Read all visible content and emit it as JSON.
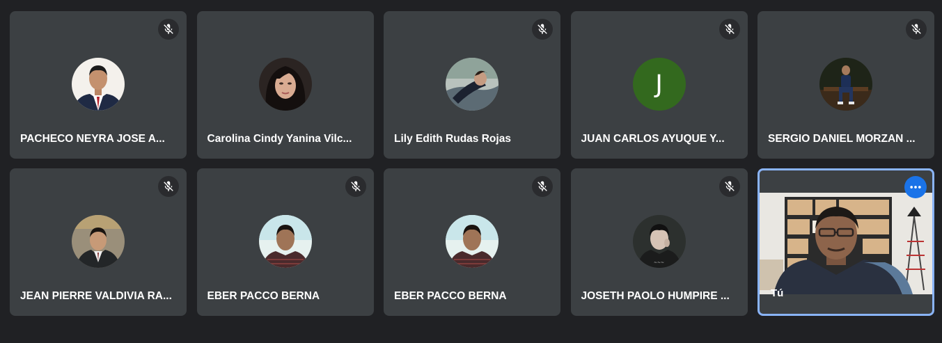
{
  "participants": [
    {
      "name": "PACHECO NEYRA JOSE A...",
      "muted": true,
      "avatar": "photo-suit-red-tie"
    },
    {
      "name": "Carolina Cindy Yanina Vilc...",
      "muted": false,
      "avatar": "photo-woman"
    },
    {
      "name": "Lily Edith Rudas Rojas",
      "muted": true,
      "avatar": "photo-outdoor"
    },
    {
      "name": "JUAN CARLOS AYUQUE Y...",
      "muted": true,
      "avatar": "letter",
      "initial": "J",
      "avatar_color": "#33691e"
    },
    {
      "name": "SERGIO DANIEL MORZAN ...",
      "muted": true,
      "avatar": "photo-sitting"
    },
    {
      "name": "JEAN PIERRE VALDIVIA RA...",
      "muted": true,
      "avatar": "photo-child-suit"
    },
    {
      "name": "EBER PACCO BERNA",
      "muted": true,
      "avatar": "photo-young-man"
    },
    {
      "name": "EBER PACCO BERNA",
      "muted": true,
      "avatar": "photo-young-man"
    },
    {
      "name": "JOSETH PAOLO HUMPIRE ...",
      "muted": true,
      "avatar": "photo-dark"
    }
  ],
  "self_tile": {
    "name": "Tú",
    "more_icon": "more-horizontal-icon",
    "highlight_color": "#8ab4f8"
  },
  "colors": {
    "background": "#202124",
    "tile": "#3c4043",
    "accent": "#1a73e8"
  }
}
